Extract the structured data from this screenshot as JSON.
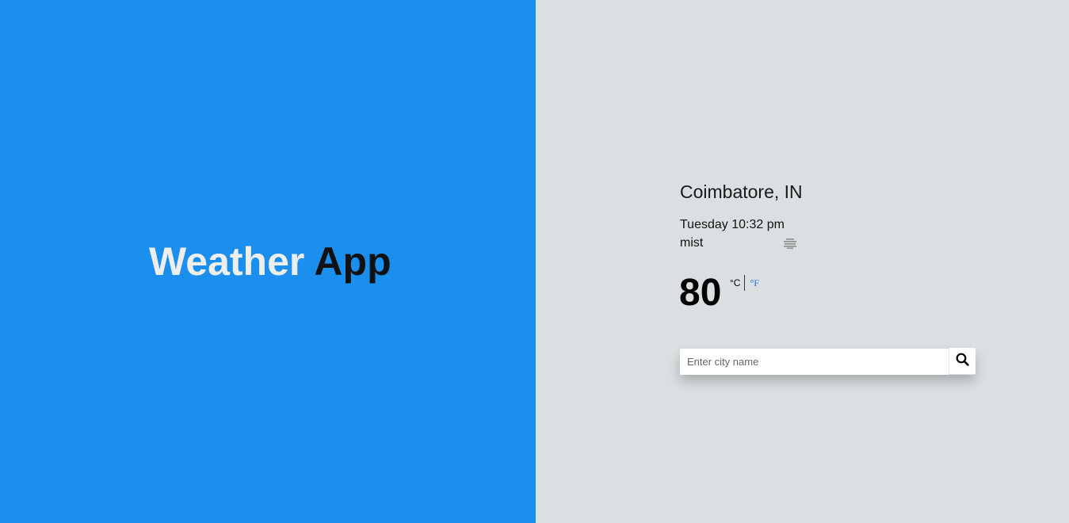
{
  "brand": {
    "word1": "Weather",
    "word2": "App"
  },
  "weather": {
    "city": "Coimbatore, IN",
    "datetime": "Tuesday 10:32 pm",
    "description": "mist",
    "icon": "mist-icon",
    "temperature": "80",
    "unit_celsius": "°C",
    "unit_fahrenheit": "°F"
  },
  "search": {
    "placeholder": "Enter city name",
    "value": "",
    "button_icon": "search-icon"
  },
  "colors": {
    "left_background": "#1a8fee",
    "right_background": "#dadfe1",
    "accent_unit": "#1a73e8"
  }
}
